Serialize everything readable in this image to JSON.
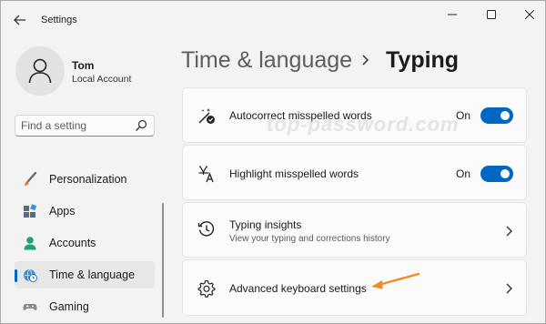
{
  "window": {
    "title": "Settings",
    "controls": [
      "minimize-icon",
      "maximize-icon",
      "close-icon"
    ]
  },
  "profile": {
    "name": "Tom",
    "account_type": "Local Account",
    "icon": "person-icon"
  },
  "search": {
    "placeholder": "Find a setting",
    "value": "",
    "icon": "search-icon"
  },
  "sidebar": {
    "items": [
      {
        "label": "Personalization",
        "icon": "brush-icon",
        "active": false
      },
      {
        "label": "Apps",
        "icon": "apps-icon",
        "active": false
      },
      {
        "label": "Accounts",
        "icon": "accounts-icon",
        "active": false
      },
      {
        "label": "Time & language",
        "icon": "globe-clock-icon",
        "active": true
      },
      {
        "label": "Gaming",
        "icon": "gamepad-icon",
        "active": false
      }
    ]
  },
  "header": {
    "parent": "Time & language",
    "current": "Typing"
  },
  "settings": [
    {
      "title": "Autocorrect misspelled words",
      "icon": "autocorrect-icon",
      "state_label": "On",
      "toggle_on": true
    },
    {
      "title": "Highlight misspelled words",
      "icon": "spellcheck-icon",
      "state_label": "On",
      "toggle_on": true
    },
    {
      "title": "Typing insights",
      "description": "View your typing and corrections history",
      "icon": "history-icon"
    },
    {
      "title": "Advanced keyboard settings",
      "icon": "gear-icon"
    }
  ],
  "watermark": "top-password.com",
  "colors": {
    "accent": "#0067c0",
    "annotation_arrow": "#f08a24",
    "window_bg": "#f3f3f3",
    "card_bg": "#fbfbfb"
  }
}
